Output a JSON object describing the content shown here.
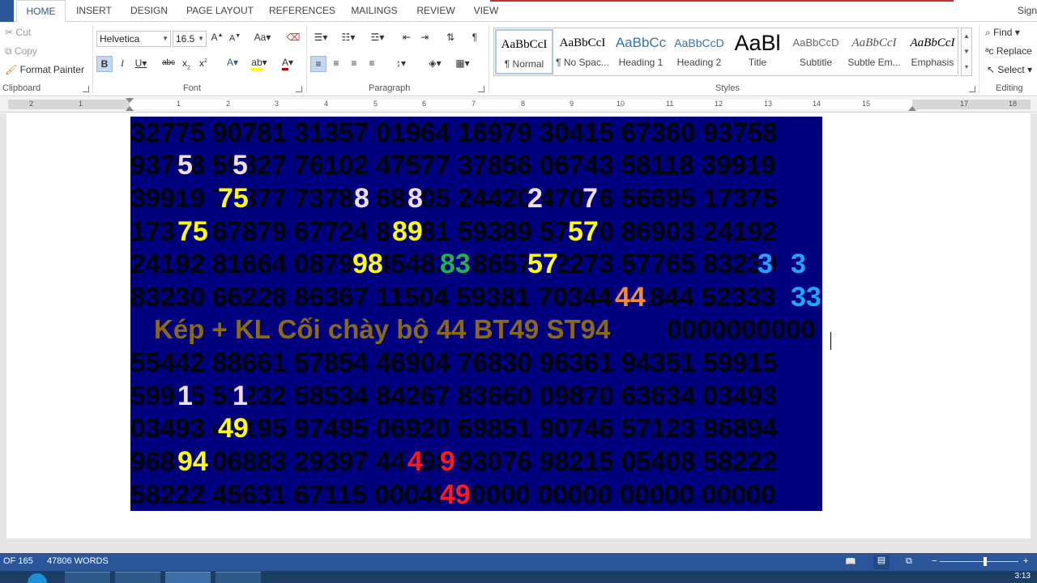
{
  "tabs": [
    "HOME",
    "INSERT",
    "DESIGN",
    "PAGE LAYOUT",
    "REFERENCES",
    "MAILINGS",
    "REVIEW",
    "VIEW"
  ],
  "active_tab": "HOME",
  "sign_in": "Sign",
  "clipboard": {
    "label": "Clipboard",
    "cut": "Cut",
    "copy": "Copy",
    "format_painter": "Format Painter"
  },
  "font": {
    "label": "Font",
    "name": "Helvetica",
    "size": "16.5"
  },
  "paragraph": {
    "label": "Paragraph"
  },
  "styles": {
    "label": "Styles",
    "items": [
      {
        "preview": "AaBbCcI",
        "name": "¶ Normal"
      },
      {
        "preview": "AaBbCcI",
        "name": "¶ No Spac..."
      },
      {
        "preview": "AaBbCc",
        "name": "Heading 1"
      },
      {
        "preview": "AaBbCcD",
        "name": "Heading 2"
      },
      {
        "preview": "AaBl",
        "name": "Title"
      },
      {
        "preview": "AaBbCcD",
        "name": "Subtitle"
      },
      {
        "preview": "AaBbCcI",
        "name": "Subtle Em..."
      },
      {
        "preview": "AaBbCcI",
        "name": "Emphasis"
      }
    ]
  },
  "editing": {
    "label": "Editing",
    "find": "Find",
    "replace": "Replace",
    "select": "Select"
  },
  "ruler_numbers": [
    "2",
    "1",
    "1",
    "2",
    "3",
    "4",
    "5",
    "6",
    "7",
    "8",
    "9",
    "10",
    "11",
    "12",
    "13",
    "14",
    "15",
    "17",
    "18"
  ],
  "document": {
    "lines": [
      "32775 90781 31357 01964 16979 30415 67360 93758",
      "93758 55827 76102 47577 37856 06743 58118 39919",
      "39919 75877 73787 68205 24420 47076 56695 17375",
      "17375 67879 67724 89581 59389 57570 86903 24192",
      "24192 81664 08798 45483 48657 32273 57765 83230",
      "83230 66228 86367 11504 59381 70344 01844 52333",
      "55442 88661 57854 46904 76830 96361 94351 59915",
      "59915 51232 58534 84267 83660 09870 63634 03493",
      "03493 49195 97495 06920 69851 90746 57123 96894",
      "96894 06883 29397 44798 93076 98215 05408 58222",
      "58222 45631 67115 00049 00000 00000 00000 00000"
    ],
    "caption": "Kép + KL Cối chày bộ 44 BT49 ST94",
    "caption_zeros": "0000000000",
    "highlights": [
      {
        "text": "5",
        "color": "#f2dede"
      },
      {
        "text": "5",
        "color": "#f2dede"
      },
      {
        "text": "75",
        "color": "#ffff00"
      },
      {
        "text": "8",
        "color": "#f2dede"
      },
      {
        "text": "8",
        "color": "#f2dede"
      },
      {
        "text": "2",
        "color": "#f2dede"
      },
      {
        "text": "7",
        "color": "#f2dede"
      },
      {
        "text": "75",
        "color": "#ffff00"
      },
      {
        "text": "89",
        "color": "#ffff00"
      },
      {
        "text": "57",
        "color": "#ffff00"
      },
      {
        "text": "98",
        "color": "#ffff00"
      },
      {
        "text": "83",
        "color": "#22b14c"
      },
      {
        "text": "57",
        "color": "#ffff00"
      },
      {
        "text": "3",
        "color": "#1fa5ff"
      },
      {
        "text": "3",
        "color": "#1fa5ff"
      },
      {
        "text": "44",
        "color": "#f28c3b"
      },
      {
        "text": "33",
        "color": "#1fa5ff"
      },
      {
        "text": "1",
        "color": "#f2dede"
      },
      {
        "text": "1",
        "color": "#f2dede"
      },
      {
        "text": "49",
        "color": "#ffff00"
      },
      {
        "text": "94",
        "color": "#ffff00"
      },
      {
        "text": "4",
        "color": "#ff1a1a"
      },
      {
        "text": "9",
        "color": "#ff1a1a"
      },
      {
        "text": "49",
        "color": "#ff1a1a"
      }
    ]
  },
  "status": {
    "page": "OF 165",
    "words": "47806 WORDS"
  },
  "clock": "3:13"
}
